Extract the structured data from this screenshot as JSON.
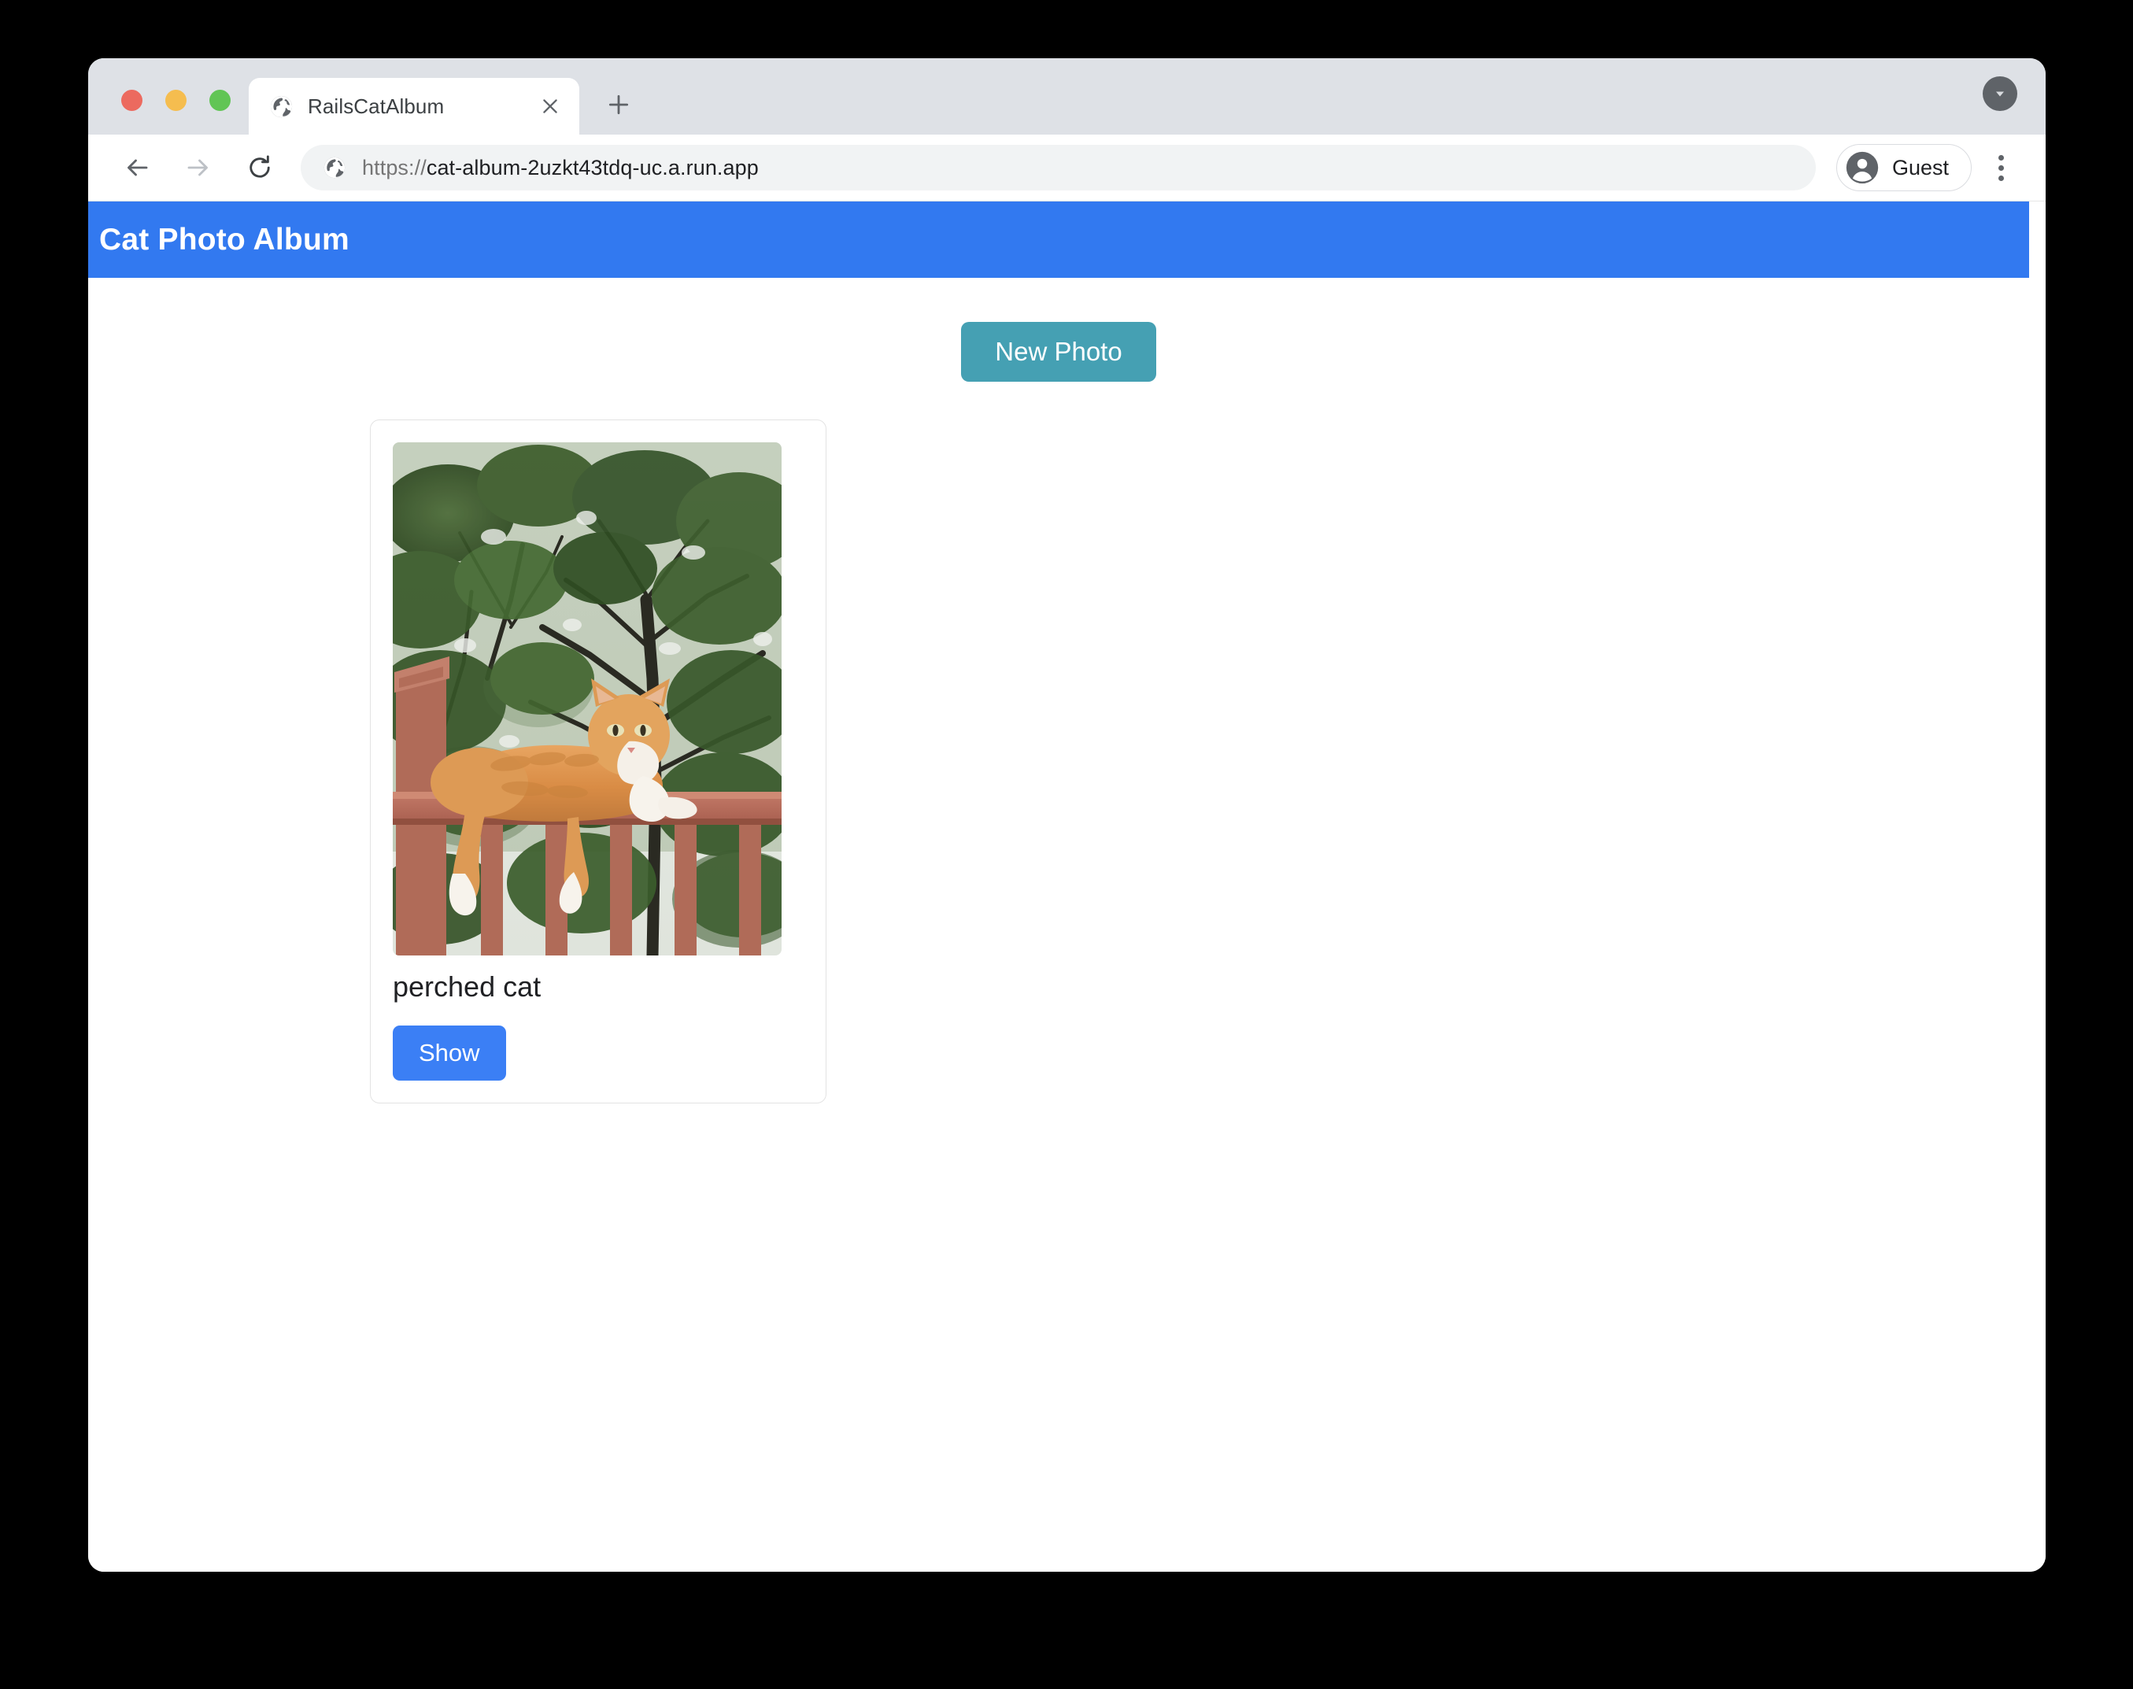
{
  "window": {
    "traffic_lights": [
      "close",
      "minimize",
      "zoom"
    ]
  },
  "tabstrip": {
    "tab_title": "RailsCatAlbum",
    "favicon": "globe-icon",
    "close_icon": "close-icon",
    "new_tab_icon": "plus-icon",
    "caret_icon": "chevron-down-icon"
  },
  "toolbar": {
    "back_icon": "back-arrow-icon",
    "forward_icon": "forward-arrow-icon",
    "reload_icon": "reload-icon",
    "site_icon": "globe-icon",
    "url_scheme": "https://",
    "url_host": "cat-album-2uzkt43tdq-uc.a.run.app",
    "url_full": "https://cat-album-2uzkt43tdq-uc.a.run.app",
    "profile_name": "Guest",
    "profile_icon": "account-circle-icon",
    "menu_icon": "kebab-menu-icon"
  },
  "app": {
    "title": "Cat Photo Album",
    "header_color": "#3279f0",
    "new_photo_label": "New Photo",
    "new_photo_color": "#45a0b3",
    "photos": [
      {
        "caption": "perched cat",
        "show_label": "Show",
        "show_color": "#3b7ff5",
        "alt": "orange tabby cat lying on a red-brown deck railing in front of green trees"
      }
    ]
  }
}
